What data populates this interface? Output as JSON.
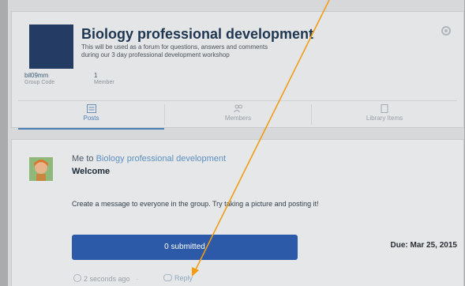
{
  "group": {
    "title": "Biology professional development",
    "description": "This will be used as a forum for questions, answers and comments during our 3 day professional development workshop",
    "code": "bil09mm",
    "code_label": "Group Code",
    "member_count": "1",
    "member_label": "Member"
  },
  "tabs": [
    {
      "label": "Posts",
      "icon": "posts-icon",
      "active": true
    },
    {
      "label": "Members",
      "icon": "members-icon",
      "active": false
    },
    {
      "label": "Library Items",
      "icon": "library-icon",
      "active": false
    }
  ],
  "post": {
    "sender": "Me",
    "to_word": "to",
    "recipient": "Biology professional development",
    "title": "Welcome",
    "body": "Create a message to everyone in the group. Try taking a picture and posting it!",
    "button_label": "0 submitted",
    "due": "Due: Mar 25, 2015",
    "timestamp": "2 seconds ago",
    "reply_label": "Reply"
  },
  "colors": {
    "accent": "#4a7fb5",
    "button": "#2d5aa8",
    "annotation": "#f39c12"
  }
}
